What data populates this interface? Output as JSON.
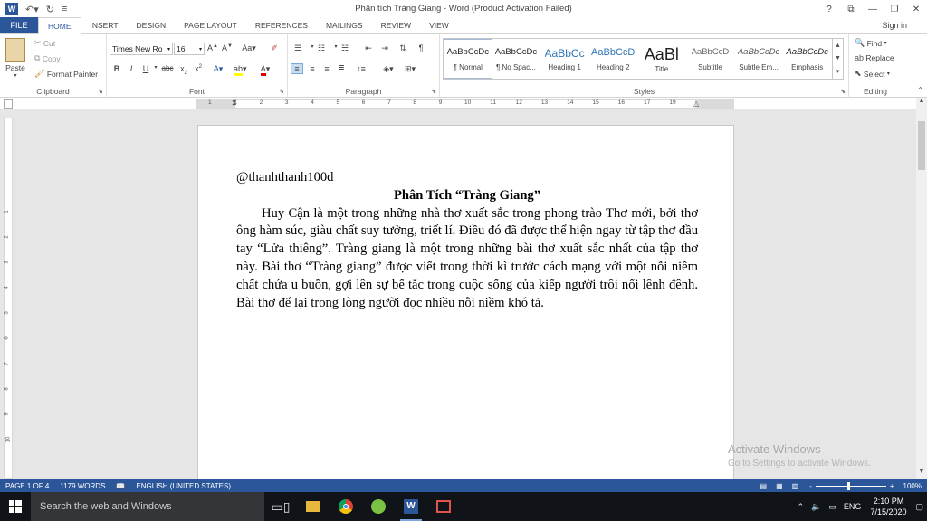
{
  "window": {
    "title": "Phân tích Tràng Giang - Word (Product Activation Failed)",
    "help": "?",
    "controls": [
      "ribbon-display",
      "minimize",
      "restore",
      "close"
    ]
  },
  "qat": {
    "undo": "undo-icon",
    "redo": "redo-icon",
    "customize": "customize-icon"
  },
  "tabs": [
    {
      "label": "FILE"
    },
    {
      "label": "HOME"
    },
    {
      "label": "INSERT"
    },
    {
      "label": "DESIGN"
    },
    {
      "label": "PAGE LAYOUT"
    },
    {
      "label": "REFERENCES"
    },
    {
      "label": "MAILINGS"
    },
    {
      "label": "REVIEW"
    },
    {
      "label": "VIEW"
    }
  ],
  "signin": "Sign in",
  "clipboard": {
    "paste": "Paste",
    "cut": "Cut",
    "copy": "Copy",
    "format_painter": "Format Painter",
    "label": "Clipboard"
  },
  "font": {
    "name": "Times New Ro",
    "size": "16",
    "label": "Font"
  },
  "paragraph": {
    "label": "Paragraph"
  },
  "styles": {
    "label": "Styles",
    "items": [
      {
        "sample": "AaBbCcDc",
        "name": "¶ Normal"
      },
      {
        "sample": "AaBbCcDc",
        "name": "¶ No Spac..."
      },
      {
        "sample": "AaBbCc",
        "name": "Heading 1"
      },
      {
        "sample": "AaBbCcD",
        "name": "Heading 2"
      },
      {
        "sample": "AaBl",
        "name": "Title"
      },
      {
        "sample": "AaBbCcD",
        "name": "Subtitle"
      },
      {
        "sample": "AaBbCcDc",
        "name": "Subtle Em..."
      },
      {
        "sample": "AaBbCcDc",
        "name": "Emphasis"
      }
    ]
  },
  "editing": {
    "find": "Find",
    "replace": "Replace",
    "select": "Select",
    "label": "Editing"
  },
  "ruler_numbers": [
    "1",
    "1",
    "2",
    "3",
    "4",
    "5",
    "6",
    "7",
    "8",
    "9",
    "10",
    "11",
    "12",
    "13",
    "14",
    "15",
    "16",
    "17",
    "19"
  ],
  "document": {
    "handle": "@thanhthanh100d",
    "heading": "Phân Tích “Tràng Giang”",
    "body": "Huy Cận là một trong những nhà thơ xuất sắc trong phong trào Thơ mới, bởi thơ ông hàm súc, giàu chất suy tưởng, triết lí. Điều đó đã được thể hiện ngay từ tập thơ đầu tay “Lửa thiêng”. Tràng giang là một trong những bài thơ xuất sắc nhất của tập thơ này. Bài thơ “Tràng giang” được viết trong thời kì trước cách mạng với một nỗi niềm chất chứa u buồn, gợi lên sự bế tắc trong cuộc sống của kiếp người trôi nổi lênh đênh. Bài thơ để lại trong lòng người đọc nhiều nỗi niềm khó tả."
  },
  "watermark": {
    "line1": "Activate Windows",
    "line2": "Go to Settings to activate Windows."
  },
  "status": {
    "page": "PAGE 1 OF 4",
    "words": "1179 WORDS",
    "language": "ENGLISH (UNITED STATES)",
    "zoom": "100%",
    "zoom_minus": "-",
    "zoom_plus": "+"
  },
  "taskbar": {
    "search_placeholder": "Search the web and Windows",
    "language": "ENG",
    "time": "2:10 PM",
    "date": "7/15/2020"
  }
}
